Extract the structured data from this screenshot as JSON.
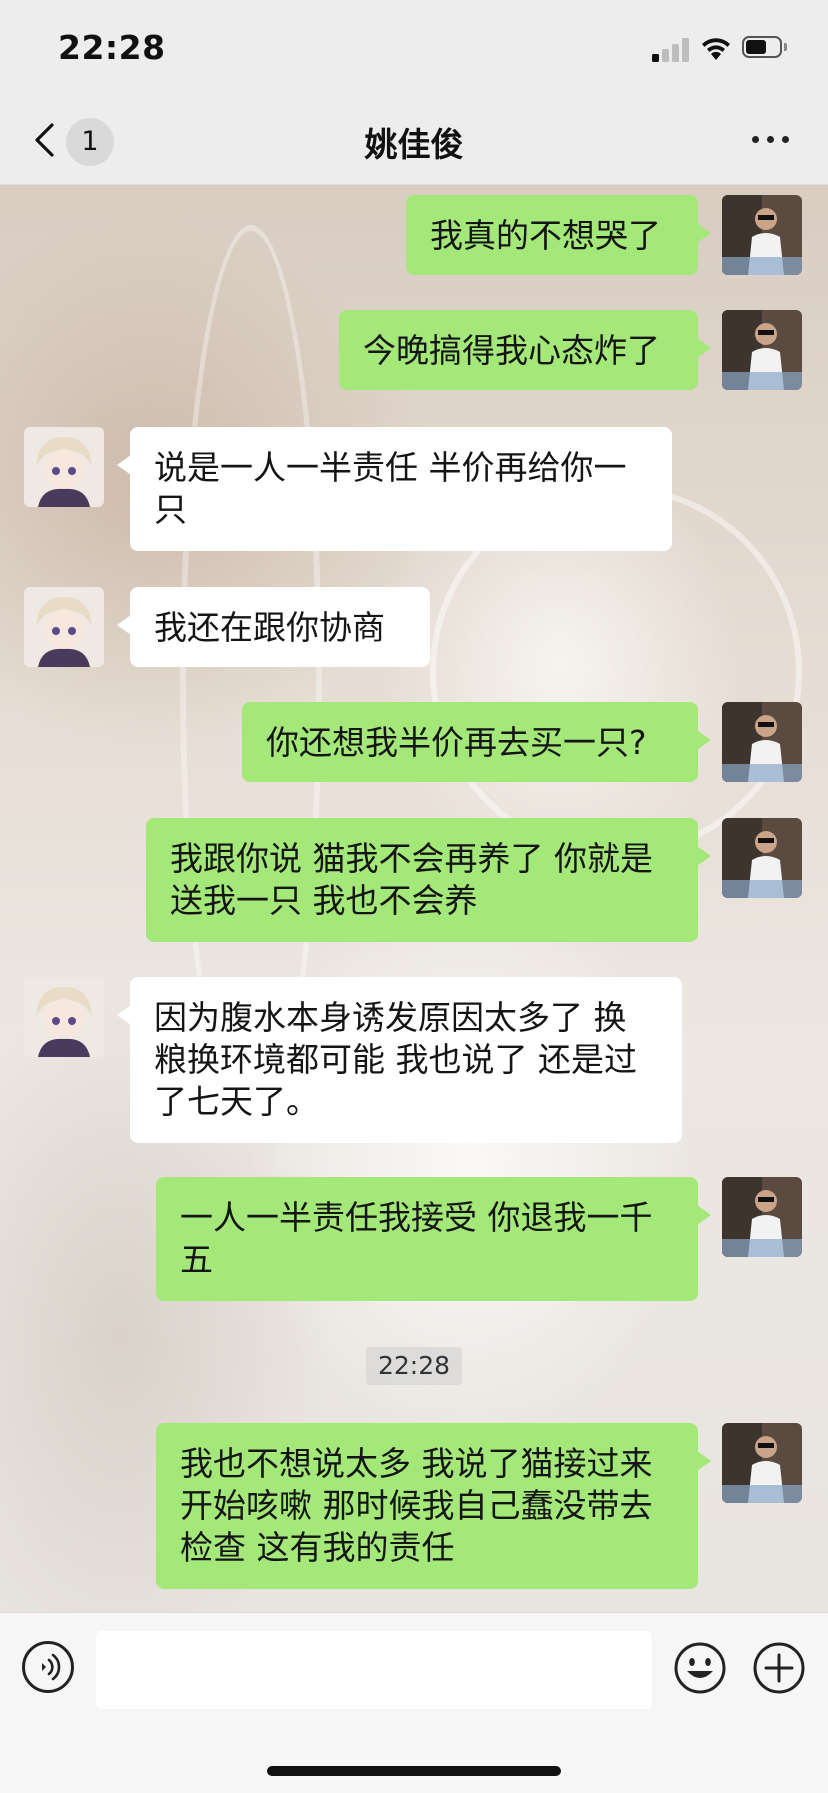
{
  "status_bar": {
    "time": "22:28",
    "icons": [
      "cellular-signal-icon",
      "wifi-icon",
      "battery-icon"
    ],
    "signal_bars_active": 1,
    "signal_bars_total": 4,
    "battery_level": 0.5
  },
  "nav": {
    "back_icon": "chevron-left-icon",
    "unread_count": "1",
    "title": "姚佳俊",
    "more_icon": "ellipsis-icon"
  },
  "colors": {
    "sent_bubble": "#a4e87a",
    "received_bubble": "#ffffff",
    "header_bg": "#ededed"
  },
  "messages": [
    {
      "direction": "sent",
      "text": "我真的不想哭了"
    },
    {
      "direction": "sent",
      "text": "今晚搞得我心态炸了"
    },
    {
      "direction": "received",
      "text": "说是一人一半责任 半价再给你一只"
    },
    {
      "direction": "received",
      "text": "我还在跟你协商"
    },
    {
      "direction": "sent",
      "text": "你还想我半价再去买一只?"
    },
    {
      "direction": "sent",
      "text": "我跟你说 猫我不会再养了 你就是送我一只 我也不会养"
    },
    {
      "direction": "received",
      "text": "因为腹水本身诱发原因太多了 换粮换环境都可能 我也说了 还是过了七天了。"
    },
    {
      "direction": "sent",
      "text": "一人一半责任我接受 你退我一千五"
    },
    {
      "direction": "sent",
      "text": "我也不想说太多 我说了猫接过来开始咳嗽 那时候我自己蠢没带去检查 这有我的责任"
    }
  ],
  "time_divider": "22:28",
  "input_bar": {
    "voice_icon": "voice-icon",
    "emoji_icon": "emoji-icon",
    "plus_icon": "plus-icon",
    "placeholder": ""
  }
}
